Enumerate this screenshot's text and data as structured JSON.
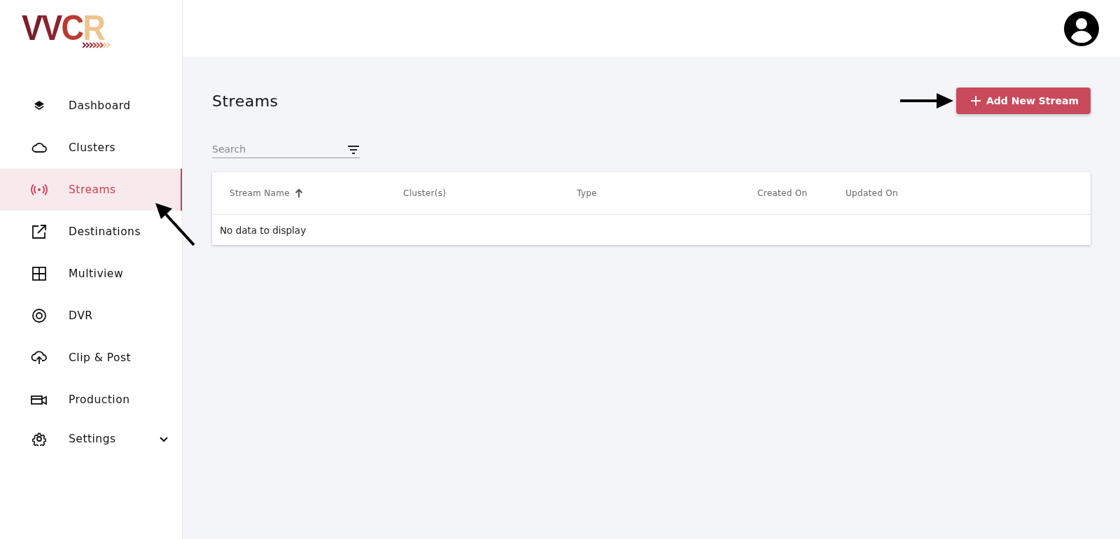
{
  "logo": {
    "letters": [
      {
        "text": "V",
        "color": "#7b1e2c"
      },
      {
        "text": "V",
        "color": "#8e2330"
      },
      {
        "text": "C",
        "color": "#b83a32"
      },
      {
        "text": "R",
        "color": "#efc48f"
      }
    ]
  },
  "sidebar": {
    "items": [
      {
        "label": "Dashboard",
        "kind": "link",
        "selected": false
      },
      {
        "label": "Clusters",
        "kind": "link",
        "selected": false
      },
      {
        "label": "Streams",
        "kind": "link",
        "selected": true
      },
      {
        "label": "Destinations",
        "kind": "link",
        "selected": false
      },
      {
        "label": "Multiview",
        "kind": "link",
        "selected": false
      },
      {
        "label": "DVR",
        "kind": "link",
        "selected": false
      },
      {
        "label": "Clip & Post",
        "kind": "link",
        "selected": false
      },
      {
        "label": "Production",
        "kind": "link",
        "selected": false
      },
      {
        "label": "Settings",
        "kind": "group",
        "selected": false,
        "expanded": false
      }
    ]
  },
  "page": {
    "title": "Streams",
    "add_button": "Add New Stream",
    "search": {
      "placeholder": "Search"
    }
  },
  "table": {
    "columns": [
      {
        "label": "Stream Name",
        "sorted": true
      },
      {
        "label": "Cluster(s)",
        "sorted": false
      },
      {
        "label": "Type",
        "sorted": false
      },
      {
        "label": "Created On",
        "sorted": false
      },
      {
        "label": "Updated On",
        "sorted": false
      }
    ],
    "empty_message": "No data to display"
  }
}
